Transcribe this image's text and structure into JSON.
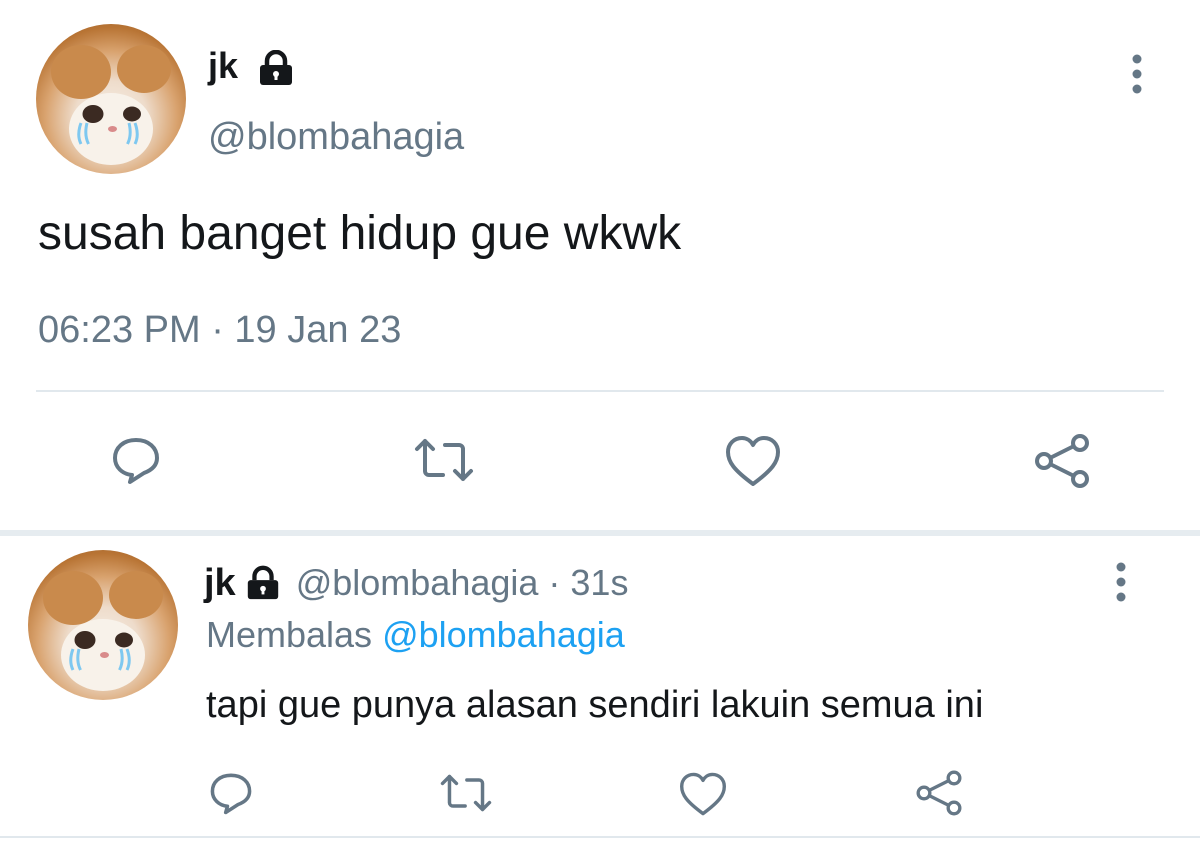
{
  "main_tweet": {
    "display_name": "jk",
    "handle": "@blombahagia",
    "text": "susah banget hidup gue wkwk",
    "timestamp": "06:23 PM · 19 Jan 23",
    "actions": [
      "reply-icon",
      "retweet-icon",
      "like-icon",
      "share-icon"
    ]
  },
  "reply_tweet": {
    "display_name": "jk",
    "handle": "@blombahagia",
    "separator": "·",
    "age": "31s",
    "replying_prefix": "Membalas",
    "replying_to": "@blombahagia",
    "text": "tapi gue punya alasan sendiri lakuin semua ini",
    "actions": [
      "reply-icon",
      "retweet-icon",
      "like-icon",
      "share-icon"
    ]
  },
  "colors": {
    "text": "#14171a",
    "secondary": "#657786",
    "link": "#1da1f2",
    "divider": "#e1e8ed"
  }
}
